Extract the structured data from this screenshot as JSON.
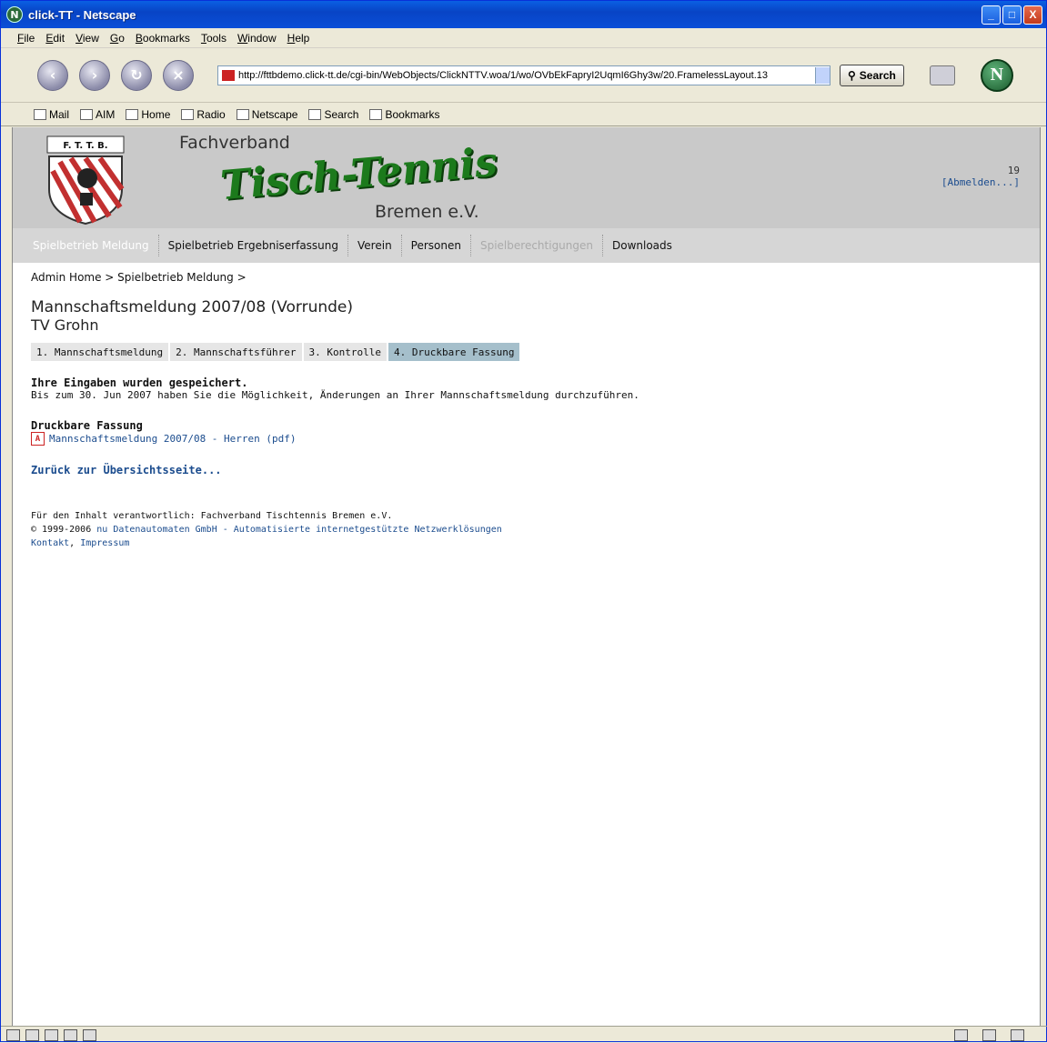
{
  "window": {
    "title": "click-TT - Netscape",
    "minimize": "_",
    "maximize": "□",
    "close": "X"
  },
  "menu": [
    "File",
    "Edit",
    "View",
    "Go",
    "Bookmarks",
    "Tools",
    "Window",
    "Help"
  ],
  "toolbar": {
    "url": "http://fttbdemo.click-tt.de/cgi-bin/WebObjects/ClickNTTV.woa/1/wo/OVbEkFapryI2UqmI6Ghy3w/20.FramelessLayout.13",
    "search_label": "Search"
  },
  "personal_toolbar": [
    "Mail",
    "AIM",
    "Home",
    "Radio",
    "Netscape",
    "Search",
    "Bookmarks"
  ],
  "header": {
    "logo_text": "F. T. T. B.",
    "line1": "Fachverband",
    "line2": "Tisch-Tennis",
    "line3": "Bremen e.V.",
    "user_number": "19",
    "logout": "[Abmelden...]"
  },
  "mainnav": [
    {
      "label": "Spielbetrieb Meldung"
    },
    {
      "label": "Spielbetrieb Ergebniserfassung"
    },
    {
      "label": "Verein"
    },
    {
      "label": "Personen"
    },
    {
      "label": "Spielberechtigungen"
    },
    {
      "label": "Downloads"
    }
  ],
  "breadcrumb": "Admin Home > Spielbetrieb Meldung >",
  "page": {
    "title": "Mannschaftsmeldung 2007/08 (Vorrunde)",
    "club": "TV Grohn",
    "steps": [
      "1. Mannschaftsmeldung",
      "2. Mannschaftsführer",
      "3. Kontrolle",
      "4. Druckbare Fassung"
    ],
    "saved_title": "Ihre Eingaben wurden gespeichert.",
    "saved_text": "Bis zum 30. Jun 2007 haben Sie die Möglichkeit, Änderungen an Ihrer Mannschaftsmeldung durchzuführen.",
    "print_heading": "Druckbare Fassung",
    "pdf_link": "Mannschaftsmeldung 2007/08 - Herren (pdf)",
    "back_link": "Zurück zur Übersichtsseite..."
  },
  "footer": {
    "line1": "Für den Inhalt verantwortlich: Fachverband Tischtennis Bremen e.V.",
    "copyright": "© 1999-2006",
    "company_link": "nu Datenautomaten GmbH - Automatisierte internetgestützte Netzwerklösungen",
    "kontakt": "Kontakt",
    "sep": ", ",
    "impressum": "Impressum"
  }
}
